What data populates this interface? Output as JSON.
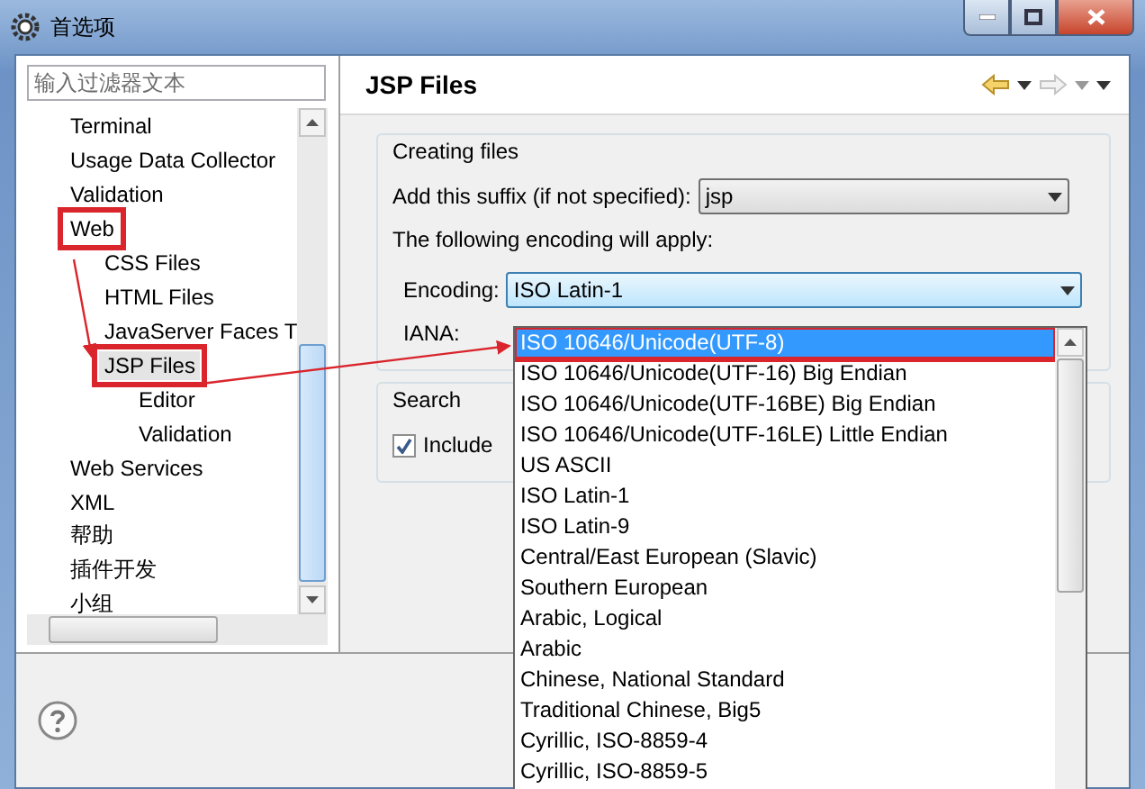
{
  "window": {
    "title": "首选项"
  },
  "filter": {
    "placeholder": "输入过滤器文本"
  },
  "tree": [
    {
      "label": "Terminal",
      "selected": false,
      "annotated": false
    },
    {
      "label": "Usage Data Collector",
      "selected": false,
      "annotated": false
    },
    {
      "label": "Validation",
      "selected": false,
      "annotated": false
    },
    {
      "label": "Web",
      "selected": false,
      "annotated": true,
      "children": [
        {
          "label": "CSS Files",
          "selected": false,
          "annotated": false
        },
        {
          "label": "HTML Files",
          "selected": false,
          "annotated": false
        },
        {
          "label": "JavaServer Faces T",
          "selected": false,
          "annotated": false
        },
        {
          "label": "JSP Files",
          "selected": true,
          "annotated": true,
          "children": [
            {
              "label": "Editor",
              "selected": false,
              "annotated": false
            },
            {
              "label": "Validation",
              "selected": false,
              "annotated": false
            }
          ]
        }
      ]
    },
    {
      "label": "Web Services",
      "selected": false,
      "annotated": false
    },
    {
      "label": "XML",
      "selected": false,
      "annotated": false
    },
    {
      "label": "帮助",
      "selected": false,
      "annotated": false
    },
    {
      "label": "插件开发",
      "selected": false,
      "annotated": false
    },
    {
      "label": "小组",
      "selected": false,
      "annotated": false
    }
  ],
  "page": {
    "title": "JSP Files"
  },
  "creating_files": {
    "title": "Creating files",
    "suffix_label": "Add this suffix (if not specified):",
    "suffix_value": "jsp",
    "encoding_note": "The following encoding will apply:",
    "encoding_label": "Encoding:",
    "encoding_value": "ISO Latin-1",
    "iana_label": "IANA:"
  },
  "search": {
    "title": "Search",
    "include": {
      "label": "Include",
      "checked": true
    }
  },
  "encoding_list": [
    {
      "label": "ISO 10646/Unicode(UTF-8)",
      "selected": true,
      "annotated": true
    },
    {
      "label": "ISO 10646/Unicode(UTF-16) Big Endian",
      "selected": false,
      "annotated": false
    },
    {
      "label": "ISO 10646/Unicode(UTF-16BE) Big Endian",
      "selected": false,
      "annotated": false
    },
    {
      "label": "ISO 10646/Unicode(UTF-16LE) Little Endian",
      "selected": false,
      "annotated": false
    },
    {
      "label": "US ASCII",
      "selected": false,
      "annotated": false
    },
    {
      "label": "ISO Latin-1",
      "selected": false,
      "annotated": false
    },
    {
      "label": "ISO Latin-9",
      "selected": false,
      "annotated": false
    },
    {
      "label": "Central/East European (Slavic)",
      "selected": false,
      "annotated": false
    },
    {
      "label": "Southern European",
      "selected": false,
      "annotated": false
    },
    {
      "label": "Arabic, Logical",
      "selected": false,
      "annotated": false
    },
    {
      "label": "Arabic",
      "selected": false,
      "annotated": false
    },
    {
      "label": "Chinese, National Standard",
      "selected": false,
      "annotated": false
    },
    {
      "label": "Traditional Chinese, Big5",
      "selected": false,
      "annotated": false
    },
    {
      "label": "Cyrillic, ISO-8859-4",
      "selected": false,
      "annotated": false
    },
    {
      "label": "Cyrillic, ISO-8859-5",
      "selected": false,
      "annotated": false
    }
  ]
}
